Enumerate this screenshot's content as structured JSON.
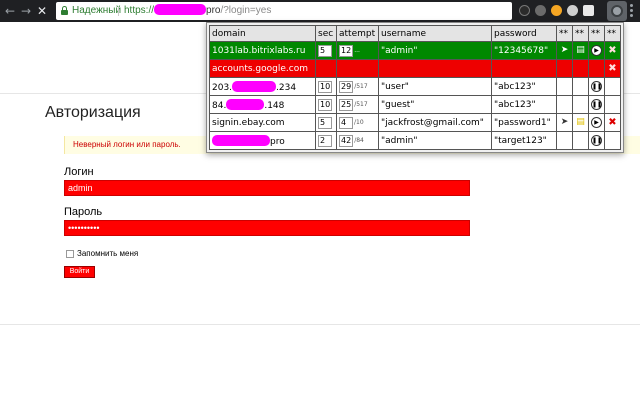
{
  "browser": {
    "secure_label": "Надежный",
    "url_protocol": "https://",
    "url_host_suffix": "pro",
    "url_path": "/?login=yes"
  },
  "page": {
    "title": "Авторизация",
    "error": "Неверный логин или пароль.",
    "login_label": "Логин",
    "login_value": "admin",
    "password_label": "Пароль",
    "password_value": "••••••••••",
    "remember_label": "Запомнить меня",
    "submit_label": "Войти"
  },
  "popup": {
    "columns": [
      "domain",
      "sec",
      "attempt",
      "username",
      "password",
      "**",
      "**",
      "**",
      "**"
    ],
    "rows": [
      {
        "domain": "1031lab.bitrixlabs.ru",
        "sec": "5",
        "attempt": "12",
        "attempt_extra": "...",
        "username": "\"admin\"",
        "password": "\"12345678\"",
        "state": "success"
      },
      {
        "domain": "accounts.google.com",
        "sec": "",
        "attempt": "",
        "attempt_extra": "",
        "username": "",
        "password": "",
        "state": "error"
      },
      {
        "domain_prefix": "203.",
        "domain_suffix": ".234",
        "sec": "10",
        "attempt": "29",
        "attempt_extra": "/517",
        "username": "\"user\"",
        "password": "\"abc123\"",
        "state": "normal"
      },
      {
        "domain_prefix": "84.",
        "domain_suffix": ".148",
        "sec": "10",
        "attempt": "25",
        "attempt_extra": "/517",
        "username": "\"guest\"",
        "password": "\"abc123\"",
        "state": "normal"
      },
      {
        "domain": "signin.ebay.com",
        "sec": "5",
        "attempt": "4",
        "attempt_extra": "/10",
        "username": "\"jackfrost@gmail.com\"",
        "password": "\"password1\"",
        "state": "normal"
      },
      {
        "domain_prefix": "",
        "domain_suffix": "pro",
        "sec": "2",
        "attempt": "42",
        "attempt_extra": "/84",
        "username": "\"admin\"",
        "password": "\"target123\"",
        "state": "normal"
      }
    ]
  },
  "colors": {
    "accent_red": "#ff0000",
    "success_green": "#008800",
    "redaction": "#ff00ff"
  }
}
